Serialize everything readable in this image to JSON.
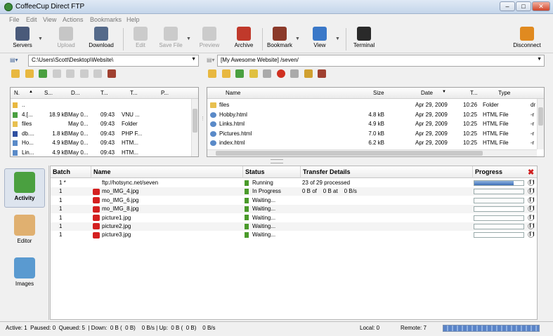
{
  "window": {
    "title": "CoffeeCup Direct FTP"
  },
  "menu": [
    "File",
    "Edit",
    "View",
    "Actions",
    "Bookmarks",
    "Help"
  ],
  "toolbar": {
    "servers": "Servers",
    "upload": "Upload",
    "download": "Download",
    "edit": "Edit",
    "save_file": "Save File",
    "preview": "Preview",
    "archive": "Archive",
    "bookmark": "Bookmark",
    "view": "View",
    "terminal": "Terminal",
    "disconnect": "Disconnect"
  },
  "local": {
    "path": "C:\\Users\\Scott\\Desktop\\Website\\",
    "columns": [
      "N.",
      "S...",
      "D...",
      "T...",
      "T...",
      "P..."
    ],
    "rows": [
      {
        "name": "..",
        "size": "",
        "date": "",
        "time": "",
        "type": ""
      },
      {
        "name": "4.[...",
        "size": "18.9 kB",
        "date": "May 0...",
        "time": "09:43",
        "type": "VNU ..."
      },
      {
        "name": "files",
        "size": "",
        "date": "May 0...",
        "time": "09:43",
        "type": "Folder"
      },
      {
        "name": "db....",
        "size": "1.8 kB",
        "date": "May 0...",
        "time": "09:43",
        "type": "PHP F..."
      },
      {
        "name": "Ho...",
        "size": "4.9 kB",
        "date": "May 0...",
        "time": "09:43",
        "type": "HTM..."
      },
      {
        "name": "Lin...",
        "size": "4.9 kB",
        "date": "May 0...",
        "time": "09:43",
        "type": "HTM..."
      }
    ]
  },
  "remote": {
    "path": "[My Awesome Website] /seven/",
    "columns": [
      "Name",
      "Size",
      "Date",
      "T...",
      "Type"
    ],
    "rows": [
      {
        "name": "files",
        "size": "",
        "date": "Apr 29, 2009",
        "time": "10:26",
        "type": "Folder",
        "extra": "dr"
      },
      {
        "name": "Hobby.html",
        "size": "4.8 kB",
        "date": "Apr 29, 2009",
        "time": "10:25",
        "type": "HTML File",
        "extra": "-r"
      },
      {
        "name": "Links.html",
        "size": "4.9 kB",
        "date": "Apr 29, 2009",
        "time": "10:25",
        "type": "HTML File",
        "extra": "-r"
      },
      {
        "name": "Pictures.html",
        "size": "7.0 kB",
        "date": "Apr 29, 2009",
        "time": "10:25",
        "type": "HTML File",
        "extra": "-r"
      },
      {
        "name": "index.html",
        "size": "6.2 kB",
        "date": "Apr 29, 2009",
        "time": "10:25",
        "type": "HTML File",
        "extra": "-r"
      }
    ]
  },
  "sidebar": {
    "activity": "Activity",
    "editor": "Editor",
    "images": "Images"
  },
  "queue": {
    "columns": [
      "Batch",
      "Name",
      "Status",
      "Transfer Details",
      "Progress"
    ],
    "rows": [
      {
        "batch": "1 *",
        "name": "ftp://hotsync.net/seven",
        "status": "Running",
        "details": "23 of 29 processed",
        "progress": 0.8
      },
      {
        "batch": "1",
        "name": "mo_IMG_4.jpg",
        "status": "In Progress",
        "details": "0 B of    0 B at    0 B/s",
        "progress": 0
      },
      {
        "batch": "1",
        "name": "mo_IMG_6.jpg",
        "status": "Waiting...",
        "details": "",
        "progress": 0
      },
      {
        "batch": "1",
        "name": "mo_IMG_8.jpg",
        "status": "Waiting...",
        "details": "",
        "progress": 0
      },
      {
        "batch": "1",
        "name": "picture1.jpg",
        "status": "Waiting...",
        "details": "",
        "progress": 0
      },
      {
        "batch": "1",
        "name": "picture2.jpg",
        "status": "Waiting...",
        "details": "",
        "progress": 0
      },
      {
        "batch": "1",
        "name": "picture3.jpg",
        "status": "Waiting...",
        "details": "",
        "progress": 0
      }
    ]
  },
  "status": {
    "summary": "Active: 1  Paused: 0  Queued: 5  | Down:  0 B (  0 B)    0 B/s | Up:  0 B (  0 B)    0 B/s",
    "local": "Local: 0",
    "remote": "Remote: 7"
  }
}
